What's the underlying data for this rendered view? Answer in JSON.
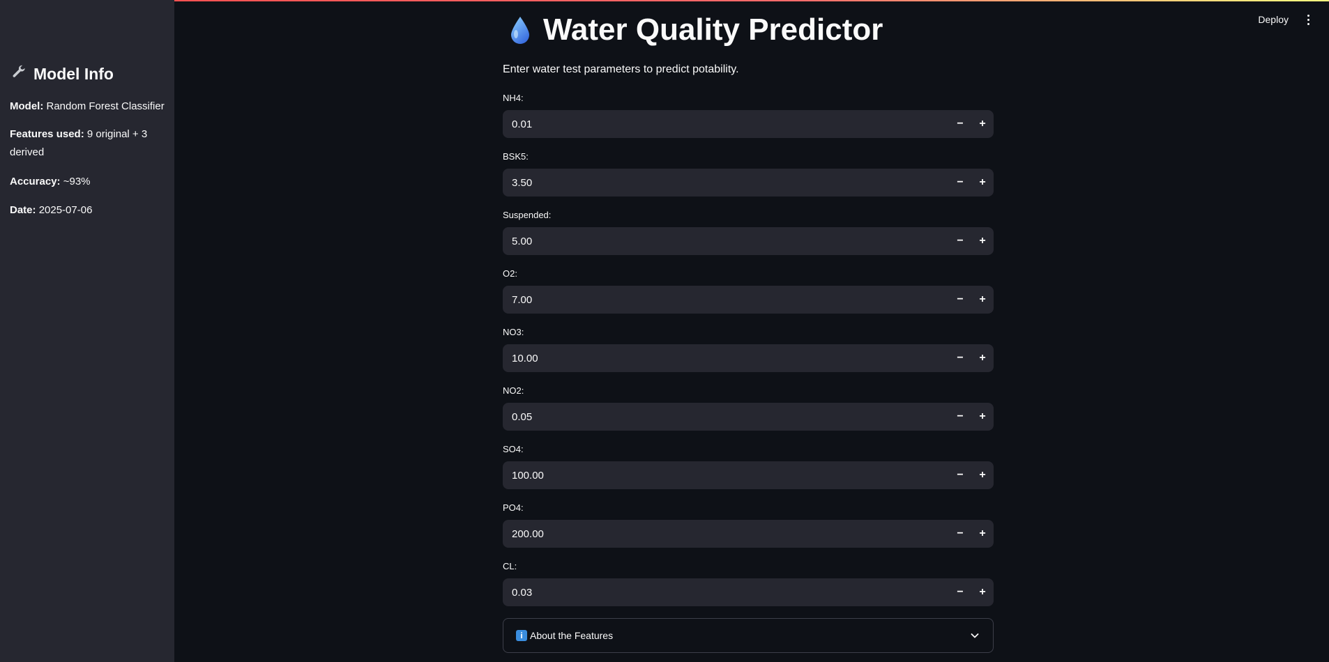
{
  "sidebar": {
    "title": "Model Info",
    "title_icon": "wrench-icon",
    "items": [
      {
        "key": "Model:",
        "value": "Random Forest Classifier"
      },
      {
        "key": "Features used:",
        "value": "9 original + 3 derived"
      },
      {
        "key": "Accuracy:",
        "value": "~93%"
      },
      {
        "key": "Date:",
        "value": "2025-07-06"
      }
    ]
  },
  "header": {
    "deploy_label": "Deploy",
    "menu_icon": "more-vertical-icon"
  },
  "main": {
    "title": "Water Quality Predictor",
    "title_icon": "water-drop-icon",
    "subtitle": "Enter water test parameters to predict potability.",
    "fields": [
      {
        "label": "NH4:",
        "value": "0.01"
      },
      {
        "label": "BSK5:",
        "value": "3.50"
      },
      {
        "label": "Suspended:",
        "value": "5.00"
      },
      {
        "label": "O2:",
        "value": "7.00"
      },
      {
        "label": "NO3:",
        "value": "10.00"
      },
      {
        "label": "NO2:",
        "value": "0.05"
      },
      {
        "label": "SO4:",
        "value": "100.00"
      },
      {
        "label": "PO4:",
        "value": "200.00"
      },
      {
        "label": "CL:",
        "value": "0.03"
      }
    ],
    "stepper": {
      "minus": "−",
      "plus": "+"
    },
    "expander": {
      "label": "About the Features",
      "icon": "info-icon",
      "info_glyph": "i"
    }
  },
  "colors": {
    "background": "#0e1117",
    "sidebar": "#262730",
    "input": "#262730",
    "accent": "#ff4b4b"
  }
}
